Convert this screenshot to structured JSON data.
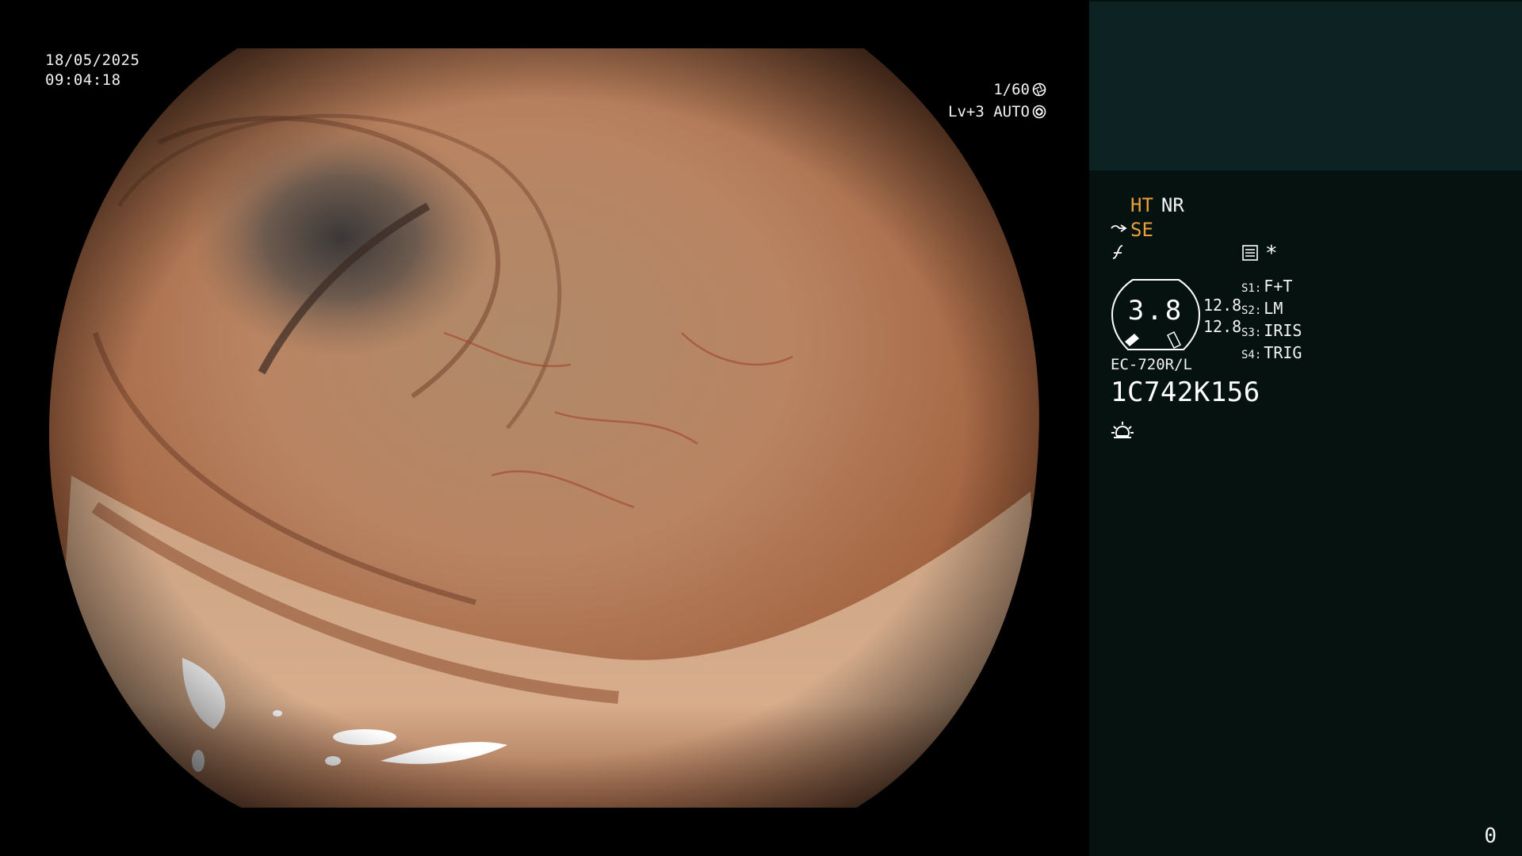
{
  "osd": {
    "date": "18/05/2025",
    "time": "09:04:18",
    "shutter": "1/60",
    "exposure_mode": "Lv+3 AUTO"
  },
  "panel": {
    "mode_ht": "HT",
    "mode_nr": "NR",
    "mode_se": "SE",
    "star": "*",
    "gauge_value": "3.8",
    "gauge_left": "12.8",
    "gauge_right": "12.8",
    "switches": [
      {
        "key": "S1:",
        "value": "F+T"
      },
      {
        "key": "S2:",
        "value": "LM"
      },
      {
        "key": "S3:",
        "value": "IRIS"
      },
      {
        "key": "S4:",
        "value": "TRIG"
      }
    ],
    "scope_model": "EC-720R/L",
    "scope_serial": "1C742K156",
    "frame_count": "0"
  },
  "icons": {
    "shutter": "shutter-aperture-icon",
    "iris": "iris-icon",
    "structure": "structure-enhancement-icon",
    "color": "color-tone-icon",
    "menu": "menu-settings-icon",
    "light": "light-source-icon"
  },
  "colors": {
    "panel_bg": "#061210",
    "panel_top": "#0c2223",
    "active_mode": "#e8a03c",
    "text": "#f2f2f2"
  }
}
